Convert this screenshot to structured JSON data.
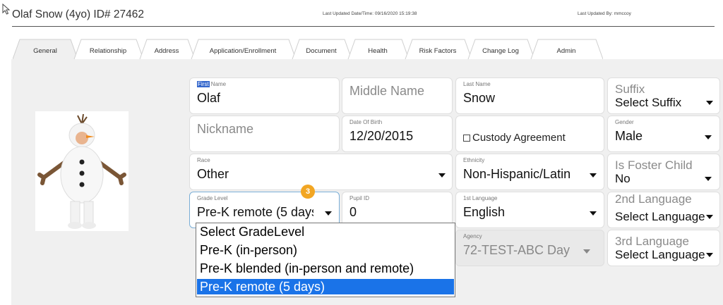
{
  "header": {
    "title": "Olaf Snow (4yo) ID# 27462",
    "last_updated": "Last Updated Date/Time: 09/16/2020 15:19:38",
    "last_updated_by": "Last Updated By: mmccoy"
  },
  "tabs": [
    {
      "label": "General",
      "active": true
    },
    {
      "label": "Relationship"
    },
    {
      "label": "Address"
    },
    {
      "label": "Application/Enrollment"
    },
    {
      "label": "Document"
    },
    {
      "label": "Health"
    },
    {
      "label": "Risk Factors"
    },
    {
      "label": "Change Log"
    },
    {
      "label": "Admin"
    }
  ],
  "photo": {
    "icon": "child-snowman-costume-photo"
  },
  "form": {
    "first_name": {
      "label_highlight": "First",
      "label_rest": " Name",
      "value": "Olaf"
    },
    "middle_name": {
      "placeholder": "Middle Name"
    },
    "last_name": {
      "label": "Last Name",
      "value": "Snow"
    },
    "suffix": {
      "label": "Suffix",
      "value": "Select Suffix"
    },
    "nickname": {
      "placeholder": "Nickname"
    },
    "dob": {
      "label": "Date Of Birth",
      "value": "12/20/2015"
    },
    "custody": {
      "label": "Custody Agreement",
      "checked": false
    },
    "gender": {
      "label": "Gender",
      "value": "Male"
    },
    "race": {
      "label": "Race",
      "value": "Other"
    },
    "ethnicity": {
      "label": "Ethnicity",
      "value": "Non-Hispanic/Latin"
    },
    "foster": {
      "label": "Is Foster Child",
      "value": "No"
    },
    "grade": {
      "label": "Grade Level",
      "value": "Pre-K remote (5 days)"
    },
    "pupil": {
      "label": "Pupil ID",
      "value": "0"
    },
    "lang1": {
      "label": "1st Language",
      "value": "English"
    },
    "lang2": {
      "label": "2nd Language",
      "value": "Select Language"
    },
    "agency": {
      "label": "Agency",
      "value": "72-TEST-ABC Day"
    },
    "lang3": {
      "label": "3rd Language",
      "value": "Select Language"
    }
  },
  "badge": "3",
  "grade_options": [
    "Select GradeLevel",
    "Pre-K (in-person)",
    "Pre-K blended (in-person and remote)",
    "Pre-K remote (5 days)"
  ],
  "selected_option_index": 3,
  "colors": {
    "selected": "#1a73e8",
    "badge": "#f2a623",
    "panel": "#f0f0f0"
  }
}
